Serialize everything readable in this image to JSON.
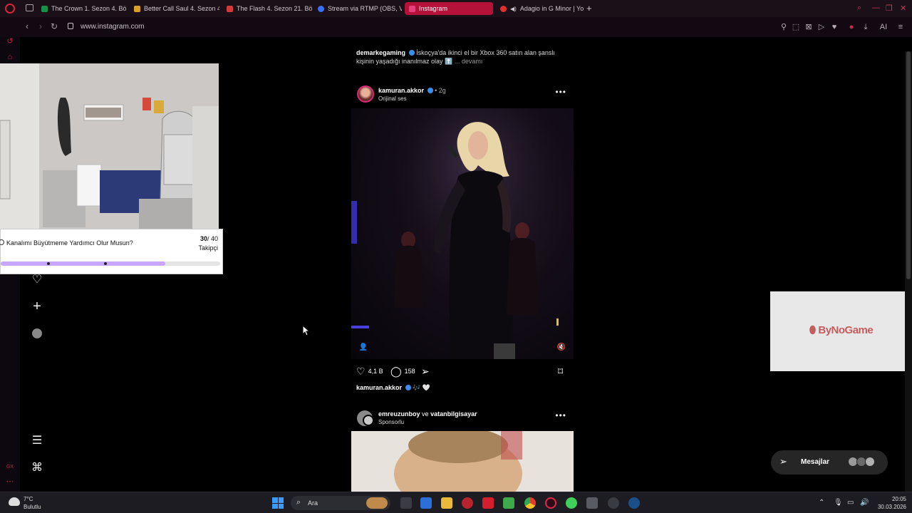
{
  "browser": {
    "tabs": [
      {
        "title": "The Crown 1. Sezon 4. Bö",
        "color": "#1a8f4a"
      },
      {
        "title": "Better Call Saul 4. Sezon 4",
        "color": "#d9a028"
      },
      {
        "title": "The Flash 4. Sezon 21. Bö",
        "color": "#d23b3b"
      },
      {
        "title": "Stream via RTMP (OBS, V",
        "color": "#3a6ff0"
      },
      {
        "title": "Instagram",
        "color": "#e6407a"
      },
      {
        "title": "Adagio in G Minor | Yo",
        "color": "#e03030"
      }
    ],
    "url": "www.instagram.com",
    "ai_label": "AI"
  },
  "feed": {
    "prev_caption": {
      "user": "demarkegaming",
      "text": "İskoçya'da ikinci el bir Xbox 360 satın alan şanslı kişinin yaşadığı inanılmaz olay",
      "emoji": "⬆️",
      "more": "... devamı"
    },
    "post": {
      "user": "kamuran.akkor",
      "time": "2g",
      "audio": "Orijinal ses",
      "likes": "4,1 B",
      "comments": "158",
      "caption_user": "kamuran.akkor",
      "caption_emoji": "🎶 🤍"
    },
    "post2": {
      "user1": "emreuzunboy",
      "and": "ve",
      "user2": "vatanbilgisayar",
      "sub": "Sponsorlu"
    }
  },
  "overlay": {
    "goal_title": "Kanalımı Büyütmeme Yardımcı Olur Musun?",
    "goal_current": "30",
    "goal_total": "/ 40",
    "goal_unit": "Takipçi",
    "goal_progress": 0.75,
    "sponsor_logo_a": "By",
    "sponsor_logo_b": "NoGame"
  },
  "messages": {
    "label": "Mesajlar"
  },
  "taskbar": {
    "temp": "7°C",
    "weather": "Bulutlu",
    "search": "Ara",
    "time": "20:05",
    "date": "30.03.2026"
  },
  "colors": {
    "accent": "#b5123a",
    "instagram_blue": "#3a8ef0",
    "goal_fill": "#c9a6ff"
  }
}
